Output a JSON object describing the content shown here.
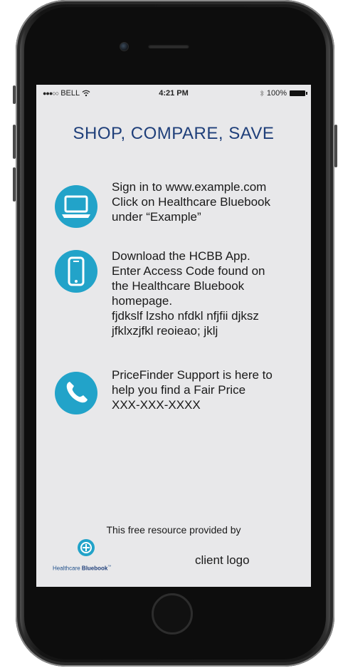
{
  "statusbar": {
    "carrier": "BELL",
    "time": "4:21 PM",
    "battery": "100%"
  },
  "title": "SHOP, COMPARE, SAVE",
  "items": [
    {
      "icon": "laptop-icon",
      "lines": [
        "Sign in to www.example.com",
        "Click on Healthcare Bluebook",
        "under “Example”"
      ]
    },
    {
      "icon": "smartphone-icon",
      "lines": [
        "Download the HCBB App.",
        "Enter Access Code found on",
        "the Healthcare Bluebook",
        "homepage.",
        "fjdkslf lzsho nfdkl nfjfii djksz",
        "jfklxzjfkl reoieao; jklj"
      ]
    },
    {
      "icon": "phone-icon",
      "lines": [
        "PriceFinder Support is here to",
        "help you find a Fair Price",
        "XXX-XXX-XXXX"
      ]
    }
  ],
  "footer": {
    "provided_by": "This free resource provided by",
    "logo_text_a": "Healthcare ",
    "logo_text_b": "Bluebook",
    "logo_tm": "™",
    "client_logo": "client logo"
  },
  "colors": {
    "accent": "#22a3c9",
    "title": "#1f3f7a",
    "screen_bg": "#e8e8ea"
  }
}
